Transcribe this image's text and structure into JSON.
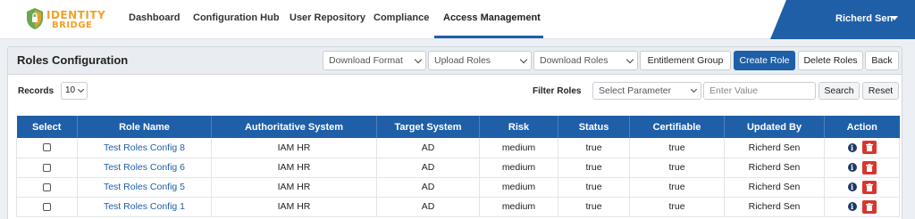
{
  "brand": {
    "line1": "IDENTITY",
    "line2": "BRIDGE",
    "color": "#f0a12a"
  },
  "nav": {
    "items": [
      {
        "label": "Dashboard"
      },
      {
        "label": "Configuration Hub"
      },
      {
        "label": "User Repository"
      },
      {
        "label": "Compliance"
      },
      {
        "label": "Access Management"
      }
    ],
    "active": "Access Management",
    "user": "Richerd Sen",
    "accent": "#1f5fa8"
  },
  "header": {
    "title": "Roles Configuration",
    "download_format": "Download Format",
    "upload_roles": "Upload Roles",
    "download_roles": "Download Roles",
    "entitlement_group": "Entitlement Group",
    "create_role": "Create Role",
    "delete_roles": "Delete Roles",
    "back": "Back"
  },
  "filters": {
    "records_label": "Records",
    "records_value": "10",
    "filter_label": "Filter Roles",
    "param_placeholder": "Select Parameter",
    "value_placeholder": "Enter Value",
    "search": "Search",
    "reset": "Reset"
  },
  "table": {
    "headers": [
      "Select",
      "Role Name",
      "Authoritative System",
      "Target System",
      "Risk",
      "Status",
      "Certifiable",
      "Updated By",
      "Action"
    ],
    "rows": [
      {
        "role": "Test Roles Config 8",
        "auth": "IAM HR",
        "target": "AD",
        "risk": "medium",
        "status": "true",
        "cert": "true",
        "updated": "Richerd Sen"
      },
      {
        "role": "Test Roles Config 6",
        "auth": "IAM HR",
        "target": "AD",
        "risk": "medium",
        "status": "true",
        "cert": "true",
        "updated": "Richerd Sen"
      },
      {
        "role": "Test Roles Config 5",
        "auth": "IAM HR",
        "target": "AD",
        "risk": "medium",
        "status": "true",
        "cert": "true",
        "updated": "Richerd Sen"
      },
      {
        "role": "Test Roles Config 1",
        "auth": "IAM HR",
        "target": "AD",
        "risk": "medium",
        "status": "true",
        "cert": "true",
        "updated": "Richerd Sen"
      }
    ],
    "delete_color": "#d9352f"
  }
}
